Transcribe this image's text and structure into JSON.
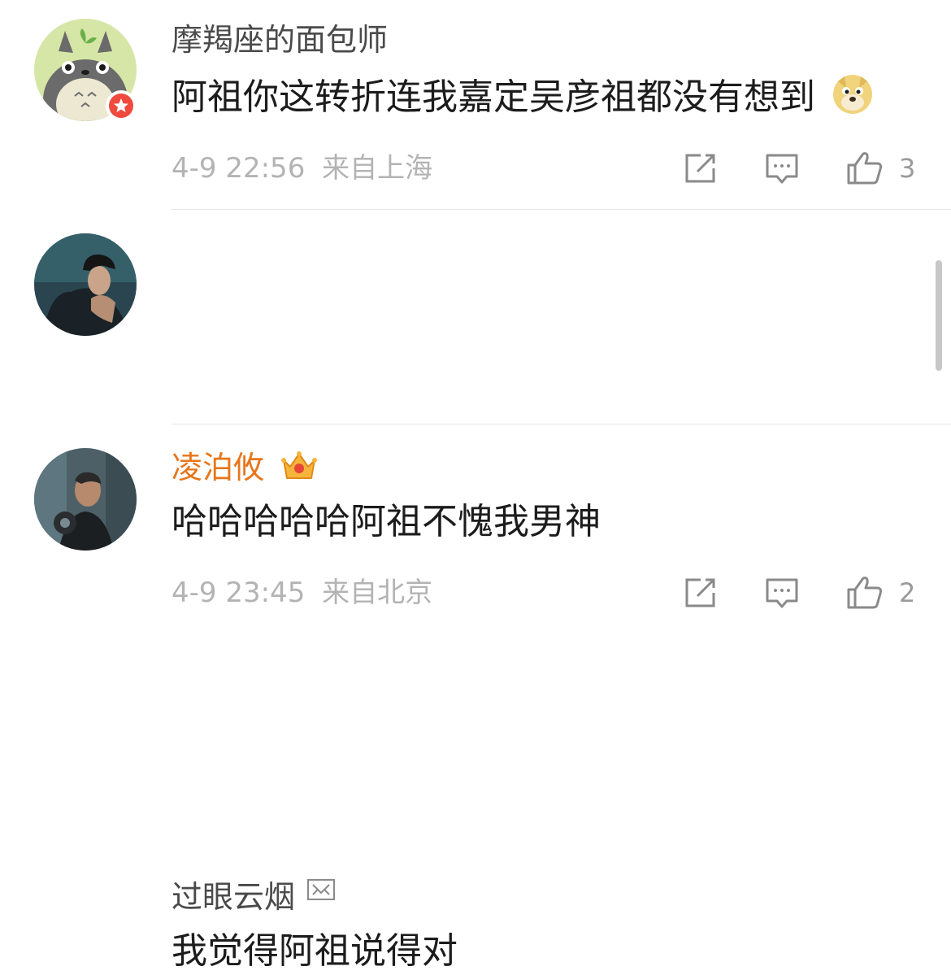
{
  "comments": [
    {
      "username": "摩羯座的面包师",
      "text": "阿祖你这转折连我嘉定吴彦祖都没有想到",
      "emoji": "doge-icon",
      "time": "4-9 22:56",
      "location": "来自上海",
      "likes": "3"
    },
    {
      "username": "凌泊攸",
      "username_color": "#e8751a",
      "text": "哈哈哈哈哈阿祖不愧我男神",
      "time": "4-9 23:45",
      "location": "来自北京",
      "likes": "2"
    },
    {
      "username": "过眼云烟",
      "text": "我觉得阿祖说得对"
    }
  ],
  "colors": {
    "accent_orange": "#e8751a",
    "meta_gray": "#b3b3b3",
    "badge_red": "#f0493e"
  }
}
